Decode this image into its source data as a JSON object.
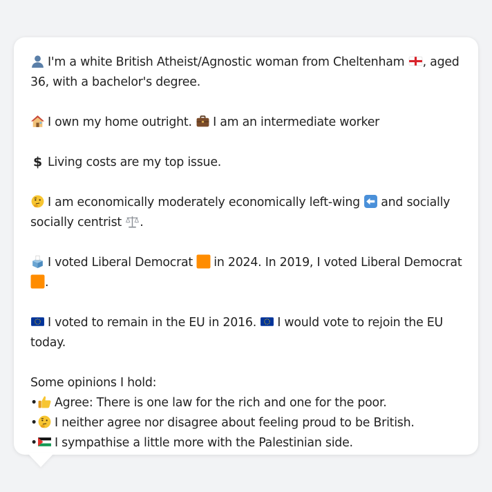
{
  "profile": {
    "identity": {
      "icon": "person-silhouette-icon",
      "text_before_flag": "I'm a white British Atheist/Agnostic woman from Cheltenham",
      "flag_icon": "england-flag-icon",
      "text_after_flag": ", aged 36, with a bachelor's degree."
    },
    "housing": {
      "home_icon": "house-icon",
      "home_text": "I own my home outright.",
      "work_icon": "briefcase-icon",
      "work_text": "I am an intermediate worker"
    },
    "issue": {
      "icon": "dollar-sign-icon",
      "text": "Living costs are my top issue."
    },
    "politics": {
      "icon": "thinking-face-icon",
      "text_before_arrow": "I am economically moderately economically left-wing",
      "arrow_icon": "left-arrow-icon",
      "text_after_arrow": "and socially socially centrist",
      "scales_icon": "balance-scale-icon",
      "text_end": "."
    },
    "votes": {
      "icon": "ballot-box-icon",
      "text_2024": "I voted Liberal Democrat",
      "party_icon": "orange-square-icon",
      "text_2019": "in 2024. In 2019, I voted Liberal Democrat",
      "text_end": "."
    },
    "eu": {
      "icon": "eu-flag-icon",
      "text_2016": "I voted to remain in the EU in 2016.",
      "text_today": "I would vote to rejoin the EU today."
    },
    "opinions": {
      "heading": "Some opinions I hold:",
      "bullet_char": "•",
      "items": [
        {
          "icon": "thumbs-up-icon",
          "text": "Agree: There is one law for the rich and one for the poor."
        },
        {
          "icon": "thinking-face-icon",
          "text": "I neither agree nor disagree about feeling proud to be British."
        },
        {
          "icon": "palestine-flag-icon",
          "text": "I sympathise a little more with the Palestinian side."
        }
      ]
    }
  },
  "colors": {
    "page_background": "#f2f3f5",
    "bubble_background": "#ffffff",
    "text": "#222222",
    "party_orange": "#ff8c00",
    "eu_blue": "#003399"
  }
}
